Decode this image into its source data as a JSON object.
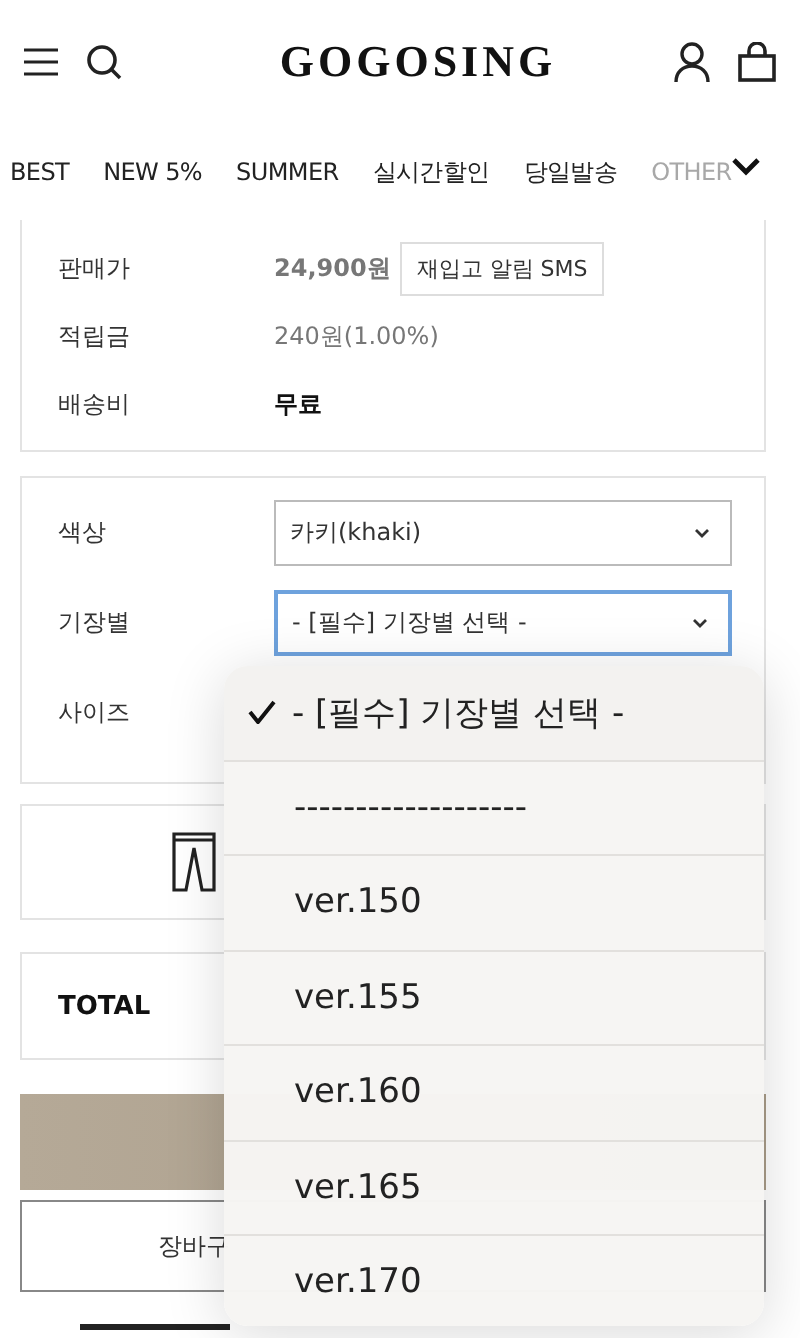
{
  "header": {
    "logo": "GOGOSING"
  },
  "nav": {
    "items": [
      {
        "label": "BEST",
        "faded": false
      },
      {
        "label": "NEW 5%",
        "faded": false
      },
      {
        "label": "SUMMER",
        "faded": false
      },
      {
        "label": "실시간할인",
        "faded": false
      },
      {
        "label": "당일발송",
        "faded": false
      },
      {
        "label": "OTHER",
        "faded": true
      }
    ]
  },
  "info": {
    "rows": [
      {
        "label": "판매가",
        "value": "24,900원",
        "kind": "price",
        "button": "재입고 알림 SMS"
      },
      {
        "label": "적립금",
        "value": "240원(1.00%)",
        "kind": "muted"
      },
      {
        "label": "배송비",
        "value": "무료",
        "kind": "bold"
      }
    ]
  },
  "options": [
    {
      "label": "색상",
      "value": "카키(khaki)",
      "focused": false
    },
    {
      "label": "기장별",
      "value": "- [필수] 기장별 선택 -",
      "focused": true
    },
    {
      "label": "사이즈"
    }
  ],
  "total": {
    "label": "TOTAL"
  },
  "cart_button": "장바구",
  "dropdown": {
    "items": [
      {
        "label": "- [필수] 기장별 선택 -",
        "selected": true
      },
      {
        "label": "-------------------",
        "selected": false
      },
      {
        "label": "ver.150",
        "selected": false
      },
      {
        "label": "ver.155",
        "selected": false
      },
      {
        "label": "ver.160",
        "selected": false
      },
      {
        "label": "ver.165",
        "selected": false
      },
      {
        "label": "ver.170",
        "selected": false
      }
    ]
  }
}
